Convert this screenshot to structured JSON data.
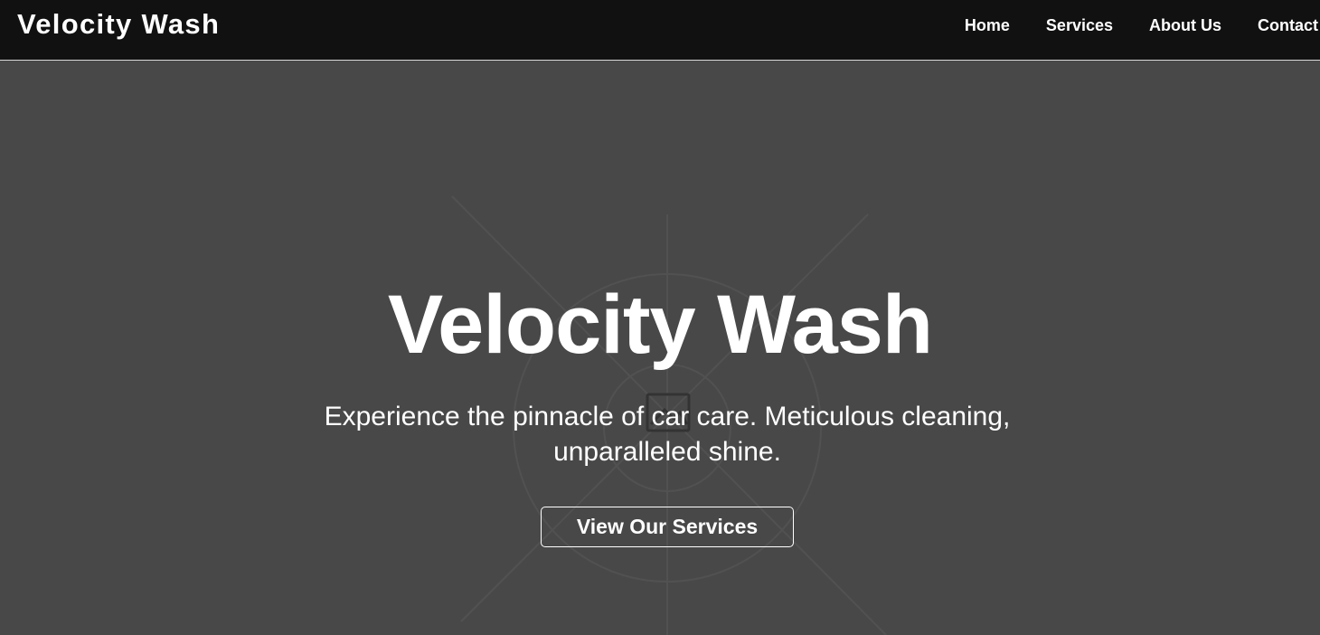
{
  "brand": {
    "name": "Velocity Wash"
  },
  "nav": {
    "items": [
      {
        "label": "Home"
      },
      {
        "label": "Services"
      },
      {
        "label": "About Us"
      },
      {
        "label": "Contact"
      }
    ]
  },
  "hero": {
    "title": "Velocity Wash",
    "subtitle": "Experience the pinnacle of car care. Meticulous cleaning, unparalleled shine.",
    "cta_label": "View Our Services",
    "background_icon": "image-placeholder-icon"
  },
  "colors": {
    "nav_background": "#111111",
    "hero_background": "#484848",
    "text": "#ffffff"
  }
}
